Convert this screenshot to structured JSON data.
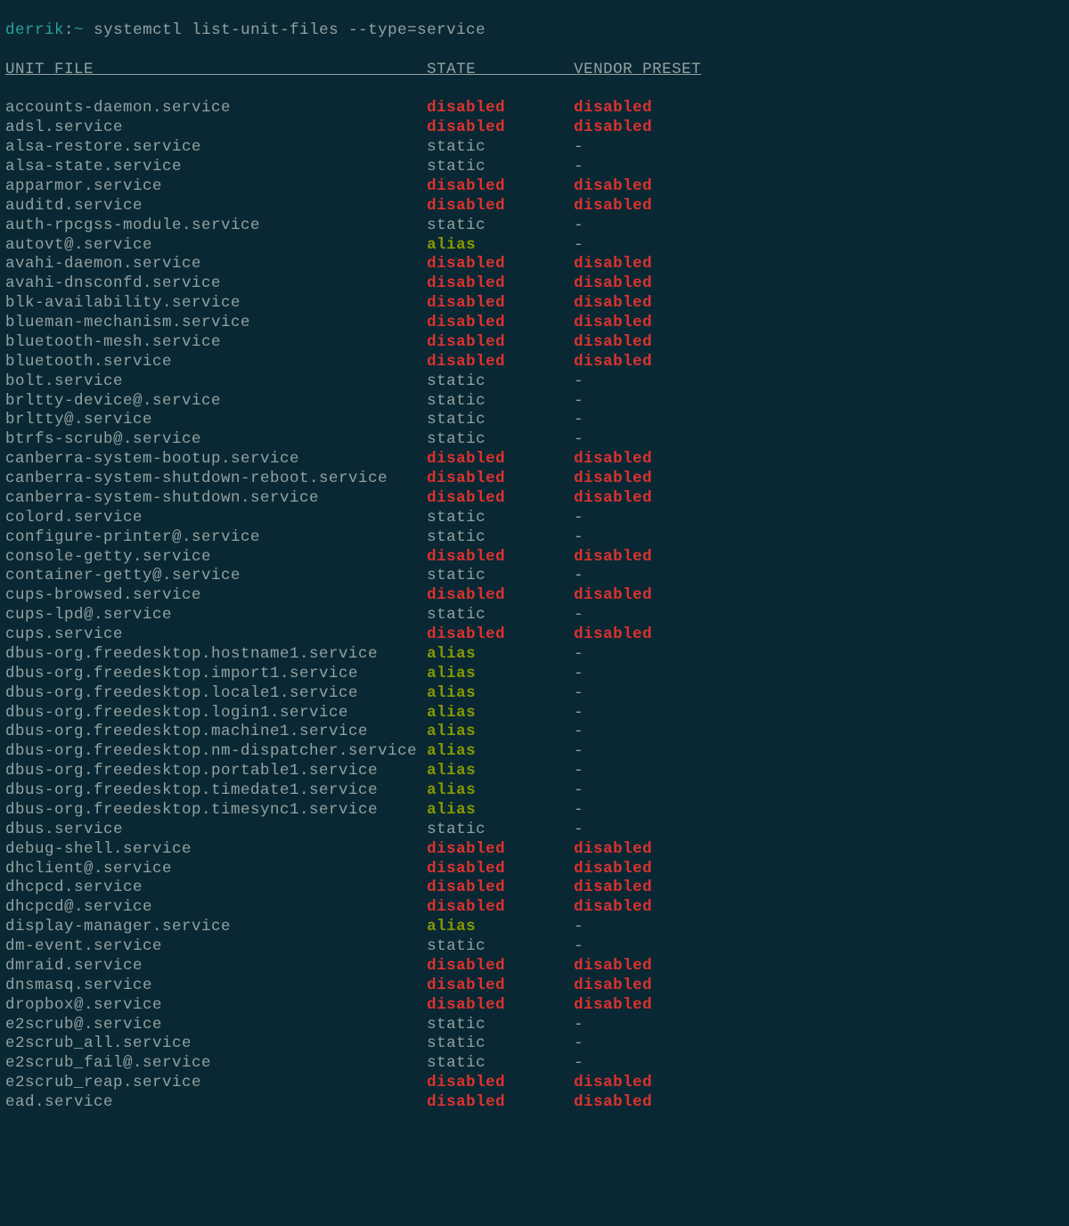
{
  "prompt": {
    "user": "derrik",
    "separator": ":",
    "path": "~",
    "command": "systemctl list-unit-files --type=service"
  },
  "headers": {
    "col1": "UNIT FILE",
    "col2": "STATE",
    "col3": "VENDOR PRESET"
  },
  "rows": [
    {
      "unit": "accounts-daemon.service",
      "state": "disabled",
      "preset": "disabled"
    },
    {
      "unit": "adsl.service",
      "state": "disabled",
      "preset": "disabled"
    },
    {
      "unit": "alsa-restore.service",
      "state": "static",
      "preset": "-"
    },
    {
      "unit": "alsa-state.service",
      "state": "static",
      "preset": "-"
    },
    {
      "unit": "apparmor.service",
      "state": "disabled",
      "preset": "disabled"
    },
    {
      "unit": "auditd.service",
      "state": "disabled",
      "preset": "disabled"
    },
    {
      "unit": "auth-rpcgss-module.service",
      "state": "static",
      "preset": "-"
    },
    {
      "unit": "autovt@.service",
      "state": "alias",
      "preset": "-"
    },
    {
      "unit": "avahi-daemon.service",
      "state": "disabled",
      "preset": "disabled"
    },
    {
      "unit": "avahi-dnsconfd.service",
      "state": "disabled",
      "preset": "disabled"
    },
    {
      "unit": "blk-availability.service",
      "state": "disabled",
      "preset": "disabled"
    },
    {
      "unit": "blueman-mechanism.service",
      "state": "disabled",
      "preset": "disabled"
    },
    {
      "unit": "bluetooth-mesh.service",
      "state": "disabled",
      "preset": "disabled"
    },
    {
      "unit": "bluetooth.service",
      "state": "disabled",
      "preset": "disabled"
    },
    {
      "unit": "bolt.service",
      "state": "static",
      "preset": "-"
    },
    {
      "unit": "brltty-device@.service",
      "state": "static",
      "preset": "-"
    },
    {
      "unit": "brltty@.service",
      "state": "static",
      "preset": "-"
    },
    {
      "unit": "btrfs-scrub@.service",
      "state": "static",
      "preset": "-"
    },
    {
      "unit": "canberra-system-bootup.service",
      "state": "disabled",
      "preset": "disabled"
    },
    {
      "unit": "canberra-system-shutdown-reboot.service",
      "state": "disabled",
      "preset": "disabled"
    },
    {
      "unit": "canberra-system-shutdown.service",
      "state": "disabled",
      "preset": "disabled"
    },
    {
      "unit": "colord.service",
      "state": "static",
      "preset": "-"
    },
    {
      "unit": "configure-printer@.service",
      "state": "static",
      "preset": "-"
    },
    {
      "unit": "console-getty.service",
      "state": "disabled",
      "preset": "disabled"
    },
    {
      "unit": "container-getty@.service",
      "state": "static",
      "preset": "-"
    },
    {
      "unit": "cups-browsed.service",
      "state": "disabled",
      "preset": "disabled"
    },
    {
      "unit": "cups-lpd@.service",
      "state": "static",
      "preset": "-"
    },
    {
      "unit": "cups.service",
      "state": "disabled",
      "preset": "disabled"
    },
    {
      "unit": "dbus-org.freedesktop.hostname1.service",
      "state": "alias",
      "preset": "-"
    },
    {
      "unit": "dbus-org.freedesktop.import1.service",
      "state": "alias",
      "preset": "-"
    },
    {
      "unit": "dbus-org.freedesktop.locale1.service",
      "state": "alias",
      "preset": "-"
    },
    {
      "unit": "dbus-org.freedesktop.login1.service",
      "state": "alias",
      "preset": "-"
    },
    {
      "unit": "dbus-org.freedesktop.machine1.service",
      "state": "alias",
      "preset": "-"
    },
    {
      "unit": "dbus-org.freedesktop.nm-dispatcher.service",
      "state": "alias",
      "preset": "-"
    },
    {
      "unit": "dbus-org.freedesktop.portable1.service",
      "state": "alias",
      "preset": "-"
    },
    {
      "unit": "dbus-org.freedesktop.timedate1.service",
      "state": "alias",
      "preset": "-"
    },
    {
      "unit": "dbus-org.freedesktop.timesync1.service",
      "state": "alias",
      "preset": "-"
    },
    {
      "unit": "dbus.service",
      "state": "static",
      "preset": "-"
    },
    {
      "unit": "debug-shell.service",
      "state": "disabled",
      "preset": "disabled"
    },
    {
      "unit": "dhclient@.service",
      "state": "disabled",
      "preset": "disabled"
    },
    {
      "unit": "dhcpcd.service",
      "state": "disabled",
      "preset": "disabled"
    },
    {
      "unit": "dhcpcd@.service",
      "state": "disabled",
      "preset": "disabled"
    },
    {
      "unit": "display-manager.service",
      "state": "alias",
      "preset": "-"
    },
    {
      "unit": "dm-event.service",
      "state": "static",
      "preset": "-"
    },
    {
      "unit": "dmraid.service",
      "state": "disabled",
      "preset": "disabled"
    },
    {
      "unit": "dnsmasq.service",
      "state": "disabled",
      "preset": "disabled"
    },
    {
      "unit": "dropbox@.service",
      "state": "disabled",
      "preset": "disabled"
    },
    {
      "unit": "e2scrub@.service",
      "state": "static",
      "preset": "-"
    },
    {
      "unit": "e2scrub_all.service",
      "state": "static",
      "preset": "-"
    },
    {
      "unit": "e2scrub_fail@.service",
      "state": "static",
      "preset": "-"
    },
    {
      "unit": "e2scrub_reap.service",
      "state": "disabled",
      "preset": "disabled"
    },
    {
      "unit": "ead.service",
      "state": "disabled",
      "preset": "disabled"
    }
  ]
}
